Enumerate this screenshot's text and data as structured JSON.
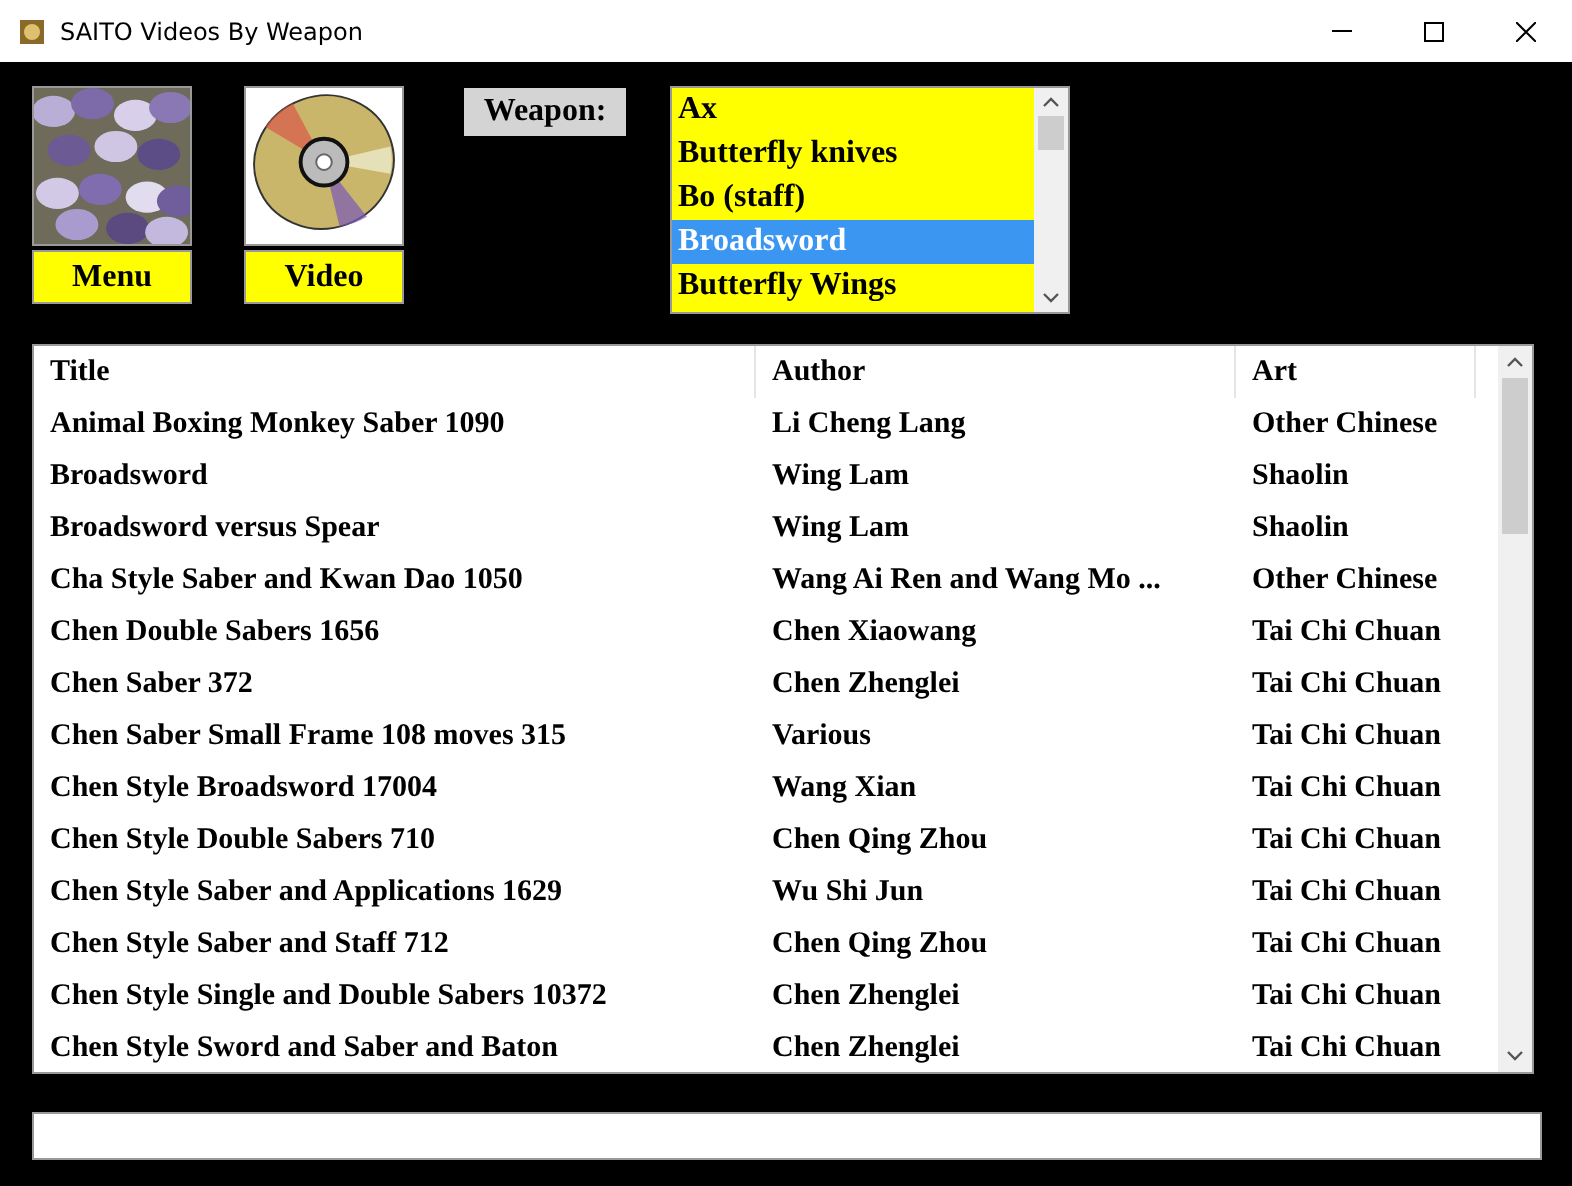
{
  "window": {
    "title": "SAITO Videos By Weapon"
  },
  "nav_buttons": [
    {
      "label": "Menu",
      "kind": "picture"
    },
    {
      "label": "Video",
      "kind": "disc"
    }
  ],
  "weapon_label": "Weapon:",
  "weapons": [
    {
      "label": "Ax",
      "selected": false
    },
    {
      "label": "Butterfly knives",
      "selected": false
    },
    {
      "label": "Bo (staff)",
      "selected": false
    },
    {
      "label": "Broadsword",
      "selected": true
    },
    {
      "label": "Butterfly Wings",
      "selected": false
    }
  ],
  "table": {
    "columns": [
      "Title",
      "Author",
      "Art"
    ],
    "rows": [
      [
        "Animal Boxing Monkey Saber 1090",
        "Li Cheng Lang",
        "Other Chinese"
      ],
      [
        "Broadsword",
        "Wing Lam",
        "Shaolin"
      ],
      [
        "Broadsword versus Spear",
        "Wing Lam",
        "Shaolin"
      ],
      [
        "Cha Style Saber and Kwan Dao 1050",
        "Wang Ai Ren and Wang Mo ...",
        "Other Chinese"
      ],
      [
        "Chen Double Sabers 1656",
        "Chen Xiaowang",
        "Tai Chi Chuan"
      ],
      [
        "Chen Saber 372",
        "Chen Zhenglei",
        "Tai Chi Chuan"
      ],
      [
        "Chen Saber Small Frame 108 moves 315",
        "Various",
        "Tai Chi Chuan"
      ],
      [
        "Chen Style Broadsword 17004",
        "Wang Xian",
        "Tai Chi Chuan"
      ],
      [
        "Chen Style Double Sabers 710",
        "Chen Qing Zhou",
        "Tai Chi Chuan"
      ],
      [
        "Chen Style Saber and Applications 1629",
        "Wu Shi Jun",
        "Tai Chi Chuan"
      ],
      [
        "Chen Style Saber and Staff 712",
        "Chen Qing Zhou",
        "Tai Chi Chuan"
      ],
      [
        "Chen Style Single and Double Sabers 10372",
        "Chen Zhenglei",
        "Tai Chi Chuan"
      ],
      [
        "Chen Style Sword and Saber and Baton",
        "Chen Zhenglei",
        "Tai Chi Chuan"
      ]
    ]
  }
}
